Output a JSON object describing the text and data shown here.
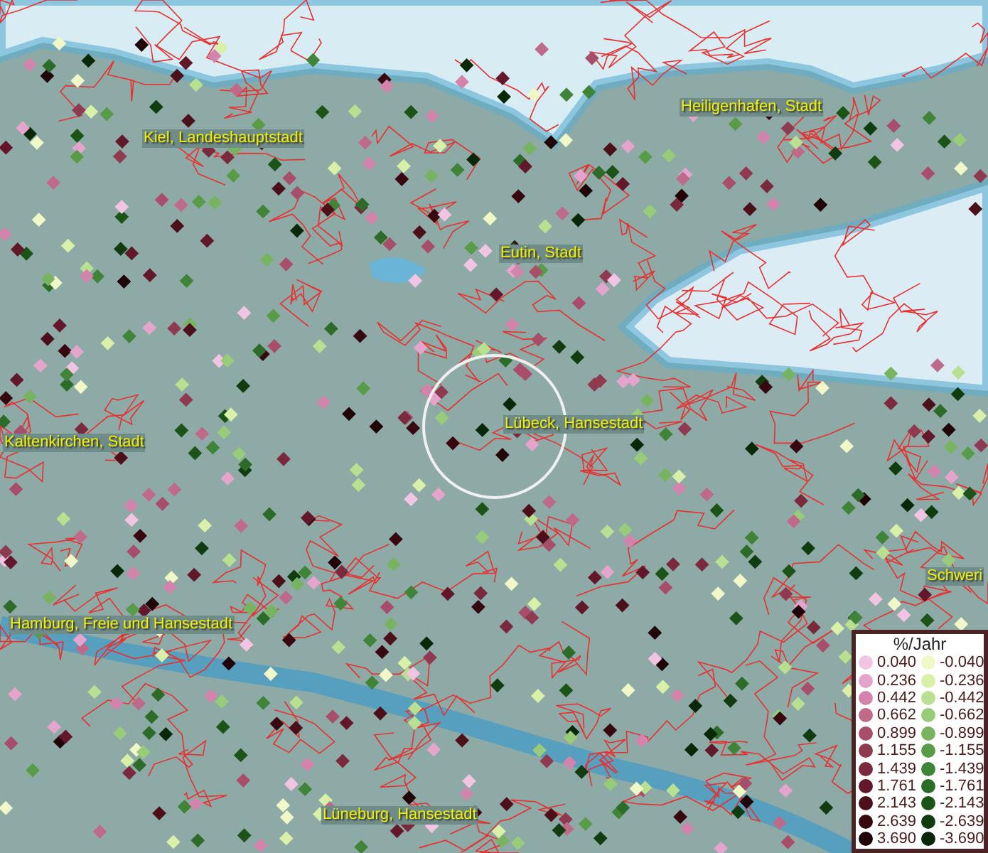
{
  "map": {
    "places": [
      {
        "name": "Kiel, Landeshauptstadt"
      },
      {
        "name": "Heiligenhafen, Stadt"
      },
      {
        "name": "Eutin, Stadt"
      },
      {
        "name": "Lübeck, Hansestadt"
      },
      {
        "name": "Kaltenkirchen, Stadt"
      },
      {
        "name": "Hamburg, Freie und Hansestadt"
      },
      {
        "name": "Lüneburg, Hansestadt"
      },
      {
        "name": "Schweri"
      }
    ]
  },
  "legend": {
    "title": "%/Jahr",
    "entries": [
      {
        "value": "0.040",
        "color": "#f2c4e4"
      },
      {
        "value": "0.236",
        "color": "#e4a4cc"
      },
      {
        "value": "0.442",
        "color": "#d484ac"
      },
      {
        "value": "0.662",
        "color": "#c06a8a"
      },
      {
        "value": "0.899",
        "color": "#a84e6a"
      },
      {
        "value": "1.155",
        "color": "#903a52"
      },
      {
        "value": "1.439",
        "color": "#7a2a3c"
      },
      {
        "value": "1.761",
        "color": "#62182a"
      },
      {
        "value": "2.143",
        "color": "#4c101a"
      },
      {
        "value": "2.639",
        "color": "#380810"
      },
      {
        "value": "3.690",
        "color": "#200408"
      },
      {
        "value": "-0.040",
        "color": "#f0f8c8"
      },
      {
        "value": "-0.236",
        "color": "#d8f0a8"
      },
      {
        "value": "-0.442",
        "color": "#b8e090"
      },
      {
        "value": "-0.662",
        "color": "#98cc78"
      },
      {
        "value": "-0.899",
        "color": "#78b460"
      },
      {
        "value": "-1.155",
        "color": "#589c48"
      },
      {
        "value": "-1.439",
        "color": "#408438"
      },
      {
        "value": "-1.761",
        "color": "#2c6c28"
      },
      {
        "value": "-2.143",
        "color": "#1c5418"
      },
      {
        "value": "-2.639",
        "color": "#103c10"
      },
      {
        "value": "-3.690",
        "color": "#082808"
      }
    ]
  }
}
